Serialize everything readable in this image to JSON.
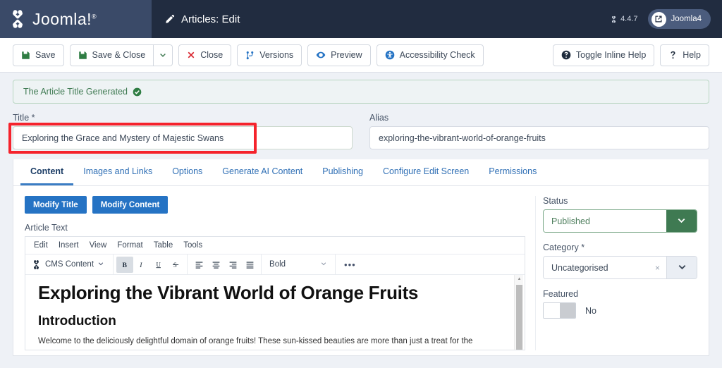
{
  "header": {
    "brand": "Joomla!",
    "brand_sup": "®",
    "page_title": "Articles: Edit",
    "pencil_icon": "pencil-icon",
    "version": "4.4.7",
    "version_icon": "joomla-mini-icon",
    "user": "Joomla4",
    "user_icon": "external-link-icon"
  },
  "toolbar": {
    "save": "Save",
    "save_close": "Save & Close",
    "close": "Close",
    "versions": "Versions",
    "preview": "Preview",
    "accessibility": "Accessibility Check",
    "toggle_help": "Toggle Inline Help",
    "help": "Help",
    "icons": {
      "save": "floppy-disk-icon",
      "save_close": "floppy-disk-icon",
      "dropdown": "chevron-down-icon",
      "close": "x-icon",
      "versions": "code-branch-icon",
      "preview": "eye-icon",
      "accessibility": "universal-access-icon",
      "toggle_help": "question-circle-icon",
      "help": "question-mark-icon"
    },
    "colors": {
      "save_icon": "#2f7d43",
      "close_icon": "#d9242d",
      "blue_icon": "#2573c4"
    }
  },
  "alert": {
    "message": "The Article Title Generated",
    "icon": "check-circle-icon",
    "color": "#3f7a52"
  },
  "fields": {
    "title_label": "Title *",
    "title_value": "Exploring the Grace and Mystery of Majestic Swans",
    "alias_label": "Alias",
    "alias_value": "exploring-the-vibrant-world-of-orange-fruits",
    "highlight_color": "#f5232c"
  },
  "tabs": [
    {
      "label": "Content",
      "active": true
    },
    {
      "label": "Images and Links",
      "active": false
    },
    {
      "label": "Options",
      "active": false
    },
    {
      "label": "Generate AI Content",
      "active": false
    },
    {
      "label": "Publishing",
      "active": false
    },
    {
      "label": "Configure Edit Screen",
      "active": false
    },
    {
      "label": "Permissions",
      "active": false
    }
  ],
  "content": {
    "modify_title_button": "Modify Title",
    "modify_content_button": "Modify Content",
    "article_text_label": "Article Text",
    "editor_menu": [
      "Edit",
      "Insert",
      "View",
      "Format",
      "Table",
      "Tools"
    ],
    "cms_content_button": "CMS Content",
    "format_select_value": "Bold",
    "overflow_button": "•••",
    "editor_buttons": {
      "bold": "B",
      "italic": "I",
      "underline": "U",
      "strikethrough": "S"
    },
    "document": {
      "h1": "Exploring the Vibrant World of Orange Fruits",
      "h2": "Introduction",
      "paragraph": "Welcome to the deliciously delightful domain of orange fruits! These sun-kissed beauties are more than just a treat for the"
    }
  },
  "sidebar": {
    "status_label": "Status",
    "status_value": "Published",
    "status_color": "#3f7a52",
    "category_label": "Category *",
    "category_value": "Uncategorised",
    "category_clear": "×",
    "featured_label": "Featured",
    "featured_value": "No"
  }
}
